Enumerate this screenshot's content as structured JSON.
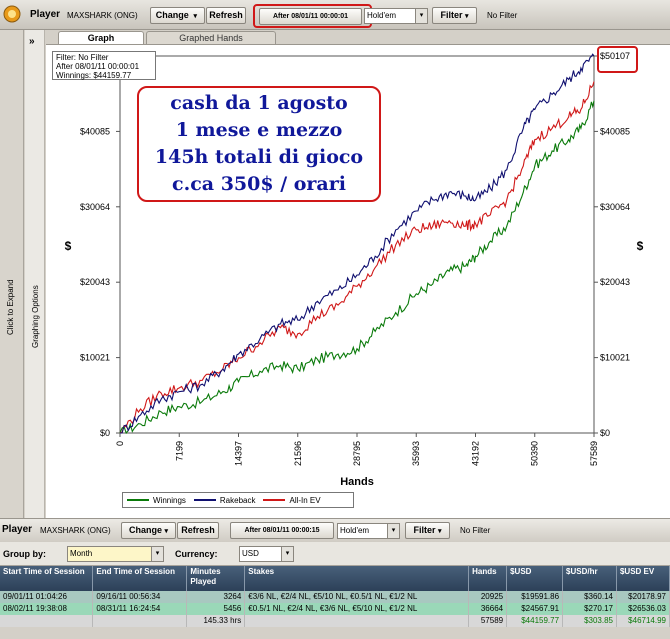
{
  "toolbar": {
    "player_label": "Player",
    "player_name": "MAXSHARK (ONG)",
    "change": "Change",
    "refresh": "Refresh",
    "date_filter": "After 08/01/11 00:00:01",
    "game": "Hold'em",
    "filter": "Filter",
    "filter_status": "No Filter"
  },
  "side": {
    "expand_arrow": "»",
    "click_to_expand": "Click to Expand",
    "graphing_options": "Graphing Options"
  },
  "tabs": [
    "Graph",
    "Graphed Hands"
  ],
  "filter_box": [
    "Filter: No Filter",
    "After 08/01/11 00:00:01",
    "Winnings: $44159.77"
  ],
  "annotation": [
    "cash da 1 agosto",
    "1 mese e mezzo",
    "145h totali di gioco",
    "c.ca 350$ / orari"
  ],
  "chart_data": {
    "type": "line",
    "xlabel": "Hands",
    "ylabel": "$",
    "xlim": [
      0,
      57589
    ],
    "ylim": [
      0,
      50107
    ],
    "x_ticks": [
      "0",
      "7199",
      "14397",
      "21596",
      "28795",
      "35993",
      "43192",
      "50390",
      "57589"
    ],
    "y_ticks_left": [
      "$0",
      "$10021",
      "$20043",
      "$30064",
      "$40085"
    ],
    "y_ticks_right": [
      "$0",
      "$10021",
      "$20043",
      "$30064",
      "$40085",
      "$50107"
    ],
    "legend": "bottom",
    "grid": false,
    "x": [
      0,
      2500,
      5000,
      7200,
      10000,
      12500,
      14400,
      17000,
      19500,
      21600,
      24000,
      26500,
      28800,
      31000,
      33500,
      36000,
      38000,
      40000,
      42000,
      43200,
      45000,
      47000,
      49000,
      50400,
      52500,
      54500,
      56000,
      57589
    ],
    "series": [
      {
        "name": "Winnings",
        "color": "#0a7a0a",
        "values": [
          0,
          1200,
          2800,
          3500,
          4200,
          5500,
          6800,
          8200,
          9000,
          8500,
          9800,
          10500,
          11200,
          13500,
          16000,
          18500,
          19800,
          21500,
          22200,
          23500,
          25500,
          27500,
          32000,
          35500,
          37500,
          39000,
          40500,
          44160
        ]
      },
      {
        "name": "Rakeback",
        "color": "#101070",
        "values": [
          0,
          2400,
          4500,
          5500,
          6500,
          8500,
          10500,
          12500,
          14500,
          15000,
          17500,
          19000,
          21000,
          23500,
          27000,
          29500,
          31000,
          32000,
          31500,
          31000,
          32500,
          35000,
          40500,
          43000,
          45000,
          47000,
          48500,
          50107
        ]
      },
      {
        "name": "All-In EV",
        "color": "#d01818",
        "values": [
          0,
          3200,
          5300,
          6000,
          7000,
          8500,
          10000,
          12000,
          14000,
          13200,
          15500,
          17000,
          19500,
          22000,
          25000,
          27000,
          27500,
          28200,
          27500,
          27800,
          29000,
          31000,
          35500,
          39000,
          40500,
          42000,
          43000,
          46715
        ]
      }
    ]
  },
  "toolbar2": {
    "player_label": "Player",
    "player_name": "MAXSHARK (ONG)",
    "change": "Change",
    "refresh": "Refresh",
    "date_filter": "After 08/01/11 00:00:15",
    "game": "Hold'em",
    "filter": "Filter",
    "filter_status": "No Filter"
  },
  "groupby": {
    "label": "Group by:",
    "value": "Month",
    "currency_label": "Currency:",
    "currency": "USD"
  },
  "table": {
    "headers": [
      "Start Time of Session",
      "End Time of Session",
      "Minutes Played",
      "Stakes",
      "Hands",
      "$USD",
      "$USD/hr",
      "$USD EV"
    ],
    "rows": [
      [
        "09/01/11 01:04:26",
        "09/16/11 00:56:34",
        "3264",
        "€3/6 NL, €2/4 NL, €5/10 NL, €0.5/1 NL, €1/2 NL",
        "20925",
        "$19591.86",
        "$360.14",
        "$20178.97"
      ],
      [
        "08/02/11 19:38:08",
        "08/31/11 16:24:54",
        "5456",
        "€0.5/1 NL, €2/4 NL, €3/6 NL, €5/10 NL, €1/2 NL",
        "36664",
        "$24567.91",
        "$270.17",
        "$26536.03"
      ]
    ],
    "totals": [
      "",
      "",
      "145.33 hrs",
      "",
      "57589",
      "$44159.77",
      "$303.85",
      "$46714.99"
    ]
  }
}
